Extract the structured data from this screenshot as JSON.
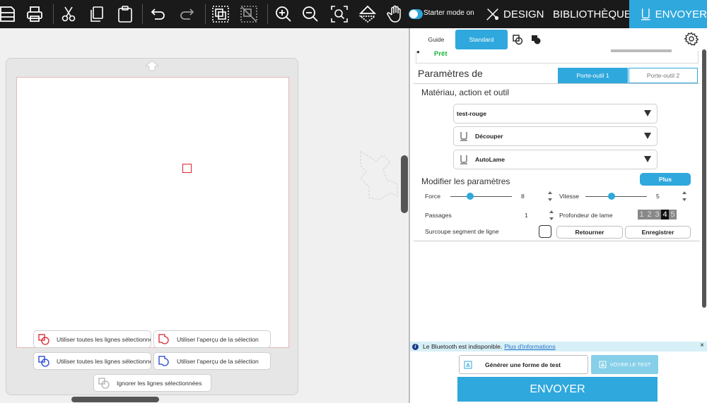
{
  "toolbar": {
    "icons": [
      "save-icon",
      "print-icon",
      "cut-icon",
      "copy-icon",
      "paste-icon",
      "undo-icon",
      "redo-icon",
      "group-icon",
      "ungroup-icon",
      "zoom-in-icon",
      "zoom-out-icon",
      "zoom-fit-icon",
      "flip-icon",
      "pan-hand-icon"
    ],
    "starter_mode_label": "Starter mode on",
    "nav": {
      "design": "DESIGN",
      "library": "BIBLIOTHÈQUE",
      "send": "ENVOYER"
    },
    "accent_color": "#2fa8dd"
  },
  "canvas": {
    "mat_color": "#e6e6e6",
    "shape_color": "#d8262c",
    "cut_options": [
      {
        "label": "Utiliser toutes les lignes sélectionnées",
        "color": "#d8262c"
      },
      {
        "label": "Utiliser l'aperçu de la sélection",
        "color": "#d8262c"
      },
      {
        "label": "Utiliser toutes les lignes sélectionnées",
        "color": "#1f3fd1"
      },
      {
        "label": "Utiliser l'aperçu de la sélection",
        "color": "#1f3fd1"
      },
      {
        "label": "Ignorer les lignes sélectionnées",
        "color": "#b0b0b0"
      }
    ]
  },
  "panel": {
    "mode_tabs": {
      "guide": "Guide",
      "standard": "Standard"
    },
    "status": "Prêt",
    "params_title": "Paramètres de",
    "tool_holders": {
      "holder1": "Porte-outil 1",
      "holder2": "Porte-outil 2"
    },
    "material_heading": "Matériau, action et outil",
    "material": "test-rouge",
    "action": "Découper",
    "tool": "AutoLame",
    "modify_heading": "Modifier les paramètres",
    "more_label": "Plus",
    "force": {
      "label": "Force",
      "value": "8",
      "fraction": 0.32
    },
    "speed": {
      "label": "Vitesse",
      "value": "5",
      "fraction": 0.43
    },
    "passes": {
      "label": "Passages",
      "value": "1"
    },
    "blade_depth": {
      "label": "Profondeur de lame",
      "digits": [
        "1",
        "2",
        "3",
        "4",
        "5"
      ],
      "selected": "4"
    },
    "overcut": {
      "label": "Surcoupe segment de ligne",
      "checked": false
    },
    "return_label": "Retourner",
    "save_label": "Enregistrer",
    "bluetooth": {
      "message": "Le Bluetooth est indisponible.",
      "link": "Plus d'informations",
      "close": "×"
    },
    "generate_test": "Générer une forme de test",
    "view_test": "VOYER LE TEST",
    "send": "ENVOYER"
  }
}
